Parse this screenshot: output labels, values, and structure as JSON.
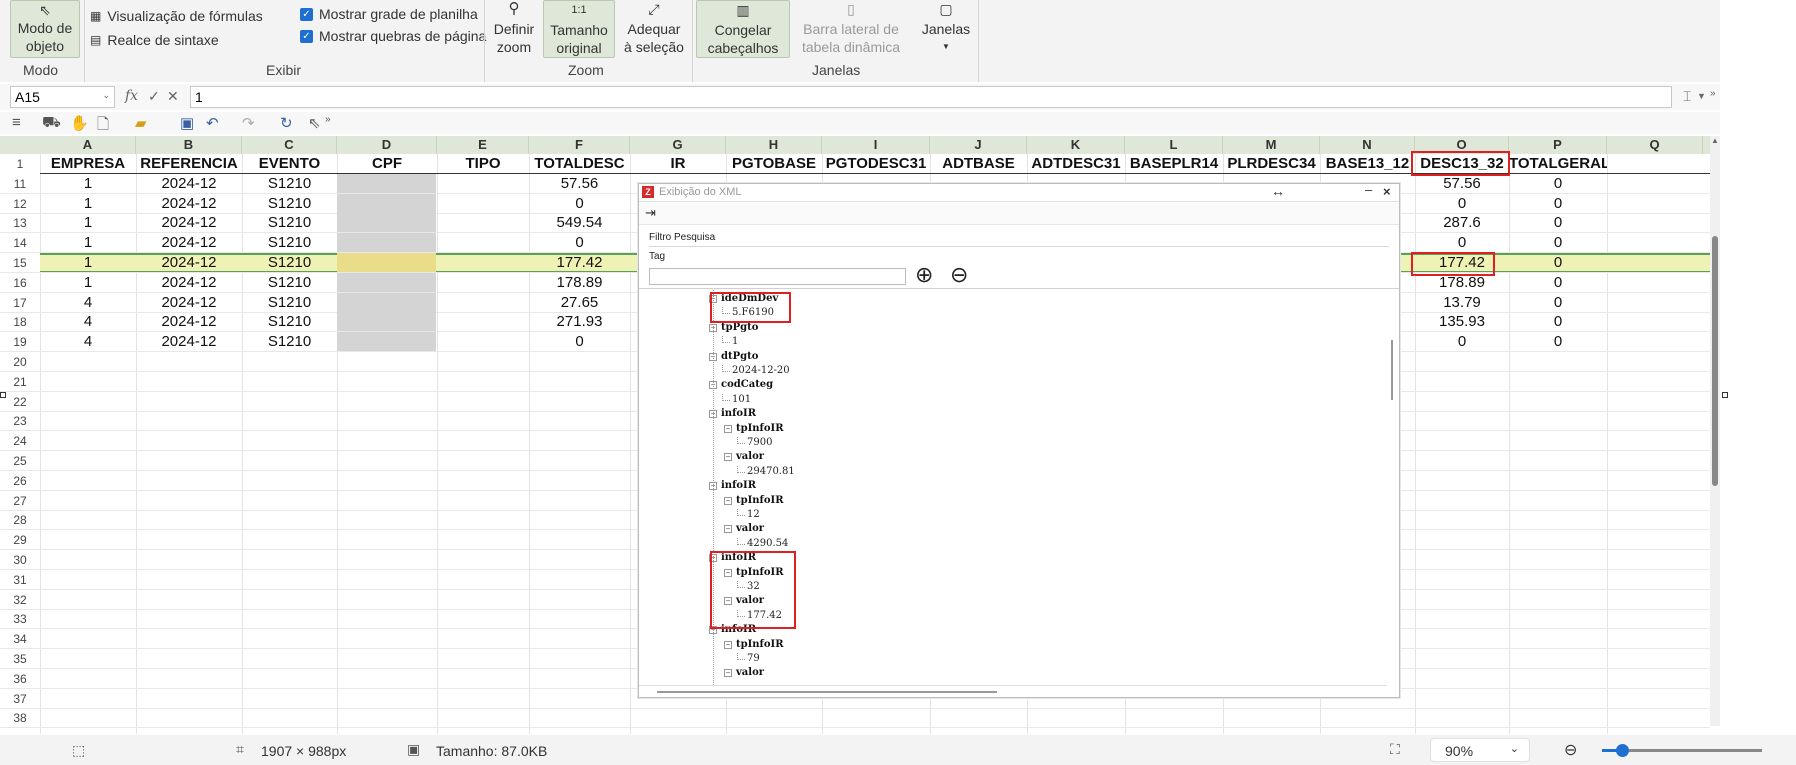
{
  "ribbon": {
    "modo_objeto": "Modo de objeto",
    "formula_view": "Visualização de fórmulas",
    "syntax_highlight": "Realce de sintaxe",
    "show_grid": "Mostrar grade de planilha",
    "show_page_breaks": "Mostrar quebras de página",
    "define_zoom": "Definir zoom",
    "original_size": "Tamanho original",
    "fit_selection": "Adequar à seleção",
    "freeze_headers": "Congelar cabeçalhos",
    "pivot_sidebar": "Barra lateral de tabela dinâmica",
    "windows": "Janelas",
    "group_modo": "Modo",
    "group_exibir": "Exibir",
    "group_zoom": "Zoom",
    "group_janelas": "Janelas"
  },
  "formula_bar": {
    "cell_ref": "A15",
    "fx": "fx",
    "value": "1"
  },
  "sheet": {
    "columns": [
      "A",
      "B",
      "C",
      "D",
      "E",
      "F",
      "G",
      "H",
      "I",
      "J",
      "K",
      "L",
      "M",
      "N",
      "O",
      "P",
      "Q"
    ],
    "header_row_num": "1",
    "headers": [
      "EMPRESA",
      "REFERENCIA",
      "EVENTO",
      "CPF",
      "TIPO",
      "TOTALDESC",
      "IR",
      "PGTOBASE",
      "PGTODESC31",
      "ADTBASE",
      "ADTDESC31",
      "BASEPLR14",
      "PLRDESC34",
      "BASE13_12",
      "DESC13_32",
      "TOTALGERAL"
    ],
    "rows": [
      {
        "num": "11",
        "empresa": "1",
        "referencia": "2024-12",
        "evento": "S1210",
        "totaldesc": "57.56",
        "desc13_32": "57.56",
        "totalgeral": "0"
      },
      {
        "num": "12",
        "empresa": "1",
        "referencia": "2024-12",
        "evento": "S1210",
        "totaldesc": "0",
        "desc13_32": "0",
        "totalgeral": "0"
      },
      {
        "num": "13",
        "empresa": "1",
        "referencia": "2024-12",
        "evento": "S1210",
        "totaldesc": "549.54",
        "desc13_32": "287.6",
        "totalgeral": "0"
      },
      {
        "num": "14",
        "empresa": "1",
        "referencia": "2024-12",
        "evento": "S1210",
        "totaldesc": "0",
        "desc13_32": "0",
        "totalgeral": "0"
      },
      {
        "num": "15",
        "empresa": "1",
        "referencia": "2024-12",
        "evento": "S1210",
        "totaldesc": "177.42",
        "desc13_32": "177.42",
        "totalgeral": "0"
      },
      {
        "num": "16",
        "empresa": "1",
        "referencia": "2024-12",
        "evento": "S1210",
        "totaldesc": "178.89",
        "desc13_32": "178.89",
        "totalgeral": "0"
      },
      {
        "num": "17",
        "empresa": "4",
        "referencia": "2024-12",
        "evento": "S1210",
        "totaldesc": "27.65",
        "desc13_32": "13.79",
        "totalgeral": "0"
      },
      {
        "num": "18",
        "empresa": "4",
        "referencia": "2024-12",
        "evento": "S1210",
        "totaldesc": "271.93",
        "desc13_32": "135.93",
        "totalgeral": "0"
      },
      {
        "num": "19",
        "empresa": "4",
        "referencia": "2024-12",
        "evento": "S1210",
        "totaldesc": "0",
        "desc13_32": "0",
        "totalgeral": "0"
      }
    ],
    "empty_rows": [
      "20",
      "21",
      "22",
      "23",
      "24",
      "25",
      "26",
      "27",
      "28",
      "29",
      "30",
      "31",
      "32",
      "33",
      "34",
      "35",
      "36",
      "37",
      "38"
    ]
  },
  "xml_dialog": {
    "title": "Exibição do XML",
    "filter_label": "Filtro Pesquisa",
    "tag_label": "Tag",
    "tag_value": "",
    "nodes": [
      {
        "label": "ideDmDev",
        "kind": "tag"
      },
      {
        "label": "5.F6190",
        "kind": "val"
      },
      {
        "label": "tpPgto",
        "kind": "tag"
      },
      {
        "label": "1",
        "kind": "val"
      },
      {
        "label": "dtPgto",
        "kind": "tag"
      },
      {
        "label": "2024-12-20",
        "kind": "val"
      },
      {
        "label": "codCateg",
        "kind": "tag"
      },
      {
        "label": "101",
        "kind": "val"
      },
      {
        "label": "infoIR",
        "kind": "tag"
      },
      {
        "label": "tpInfoIR",
        "kind": "tag"
      },
      {
        "label": "7900",
        "kind": "val"
      },
      {
        "label": "valor",
        "kind": "tag"
      },
      {
        "label": "29470.81",
        "kind": "val"
      },
      {
        "label": "infoIR",
        "kind": "tag"
      },
      {
        "label": "tpInfoIR",
        "kind": "tag"
      },
      {
        "label": "12",
        "kind": "val"
      },
      {
        "label": "valor",
        "kind": "tag"
      },
      {
        "label": "4290.54",
        "kind": "val"
      },
      {
        "label": "infoIR",
        "kind": "tag"
      },
      {
        "label": "tpInfoIR",
        "kind": "tag"
      },
      {
        "label": "32",
        "kind": "val"
      },
      {
        "label": "valor",
        "kind": "tag"
      },
      {
        "label": "177.42",
        "kind": "val"
      },
      {
        "label": "infoIR",
        "kind": "tag"
      },
      {
        "label": "tpInfoIR",
        "kind": "tag"
      },
      {
        "label": "79",
        "kind": "val"
      },
      {
        "label": "valor",
        "kind": "tag"
      }
    ]
  },
  "status_bar": {
    "dimensions": "1907 × 988px",
    "size": "Tamanho: 87.0KB",
    "zoom": "90%"
  },
  "colors": {
    "accent_red": "#e02020",
    "header_green": "#dfe7d8",
    "selected_row": "#eef2b4",
    "check_blue": "#1f6fd1"
  }
}
